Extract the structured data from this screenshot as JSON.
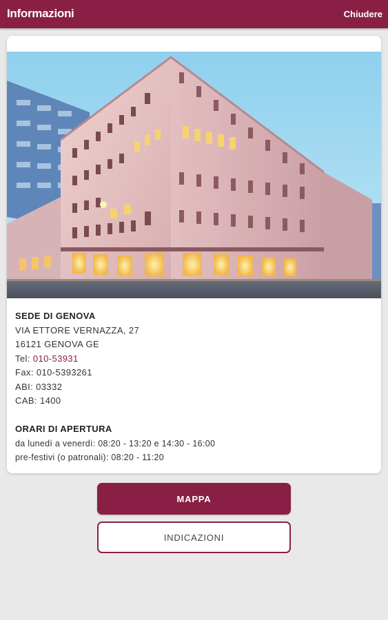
{
  "header": {
    "title": "Informazioni",
    "close_label": "Chiudere"
  },
  "branch": {
    "name": "SEDE DI GENOVA",
    "address_line1": "VIA ETTORE VERNAZZA, 27",
    "address_line2": "16121 GENOVA GE",
    "tel_label": "Tel: ",
    "tel_value": "010-53931",
    "fax": "Fax: 010-5393261",
    "abi": "ABI: 03332",
    "cab": "CAB: 1400"
  },
  "hours": {
    "title": "ORARI DI APERTURA",
    "weekdays": "da lunedì a venerdì: 08:20 - 13:20 e 14:30 - 16:00",
    "pre_holidays": "pre-festivi (o patronali): 08:20 - 11:20"
  },
  "actions": {
    "map_label": "MAPPA",
    "directions_label": "INDICAZIONI"
  },
  "colors": {
    "brand": "#8a1f45",
    "background": "#e9e9e9"
  }
}
